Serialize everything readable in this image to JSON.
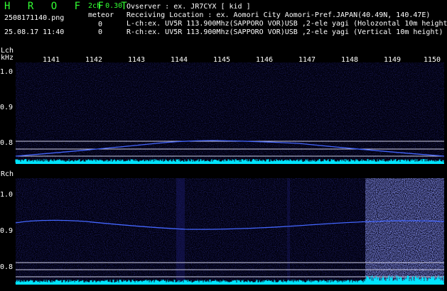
{
  "header": {
    "brand": "H R O F F T",
    "mode": "2ch 0.30",
    "filename": "2508171140.png",
    "meteor_title": "meteor",
    "datetime": "25.08.17 11:40",
    "count_l": "0",
    "count_r": "0",
    "observer": "Ovserver            : ex. JR7CYX [ kid ]",
    "location": "Receiving Location : ex. Aomori City Aomori-Pref.JAPAN(40.49N, 140.47E)",
    "lch_info": "L-ch:ex. UV5R 113.900Mhz(SAPPORO VOR)USB ,2-ele yagi (Holozontal 10m height)",
    "rch_info": "R-ch:ex. UV5R 113.900Mhz(SAPPORO VOR)USB ,2-ele yagi (Vertical 10m height)"
  },
  "lch": {
    "label": "Lch",
    "unit": "kHz",
    "yticks": [
      "1.0",
      "0.9",
      "0.8"
    ]
  },
  "rch": {
    "label": "Rch",
    "yticks": [
      "1.0",
      "0.9",
      "0.8"
    ]
  },
  "time_axis": {
    "labels": [
      "1141",
      "1142",
      "1143",
      "1144",
      "1145",
      "1146",
      "1147",
      "1148",
      "1149",
      "1150"
    ]
  },
  "colors": {
    "brand": "#33ff33",
    "trace": "#4466ff",
    "baseline": "#00e5ff",
    "noise": "#0a0a5a"
  }
}
